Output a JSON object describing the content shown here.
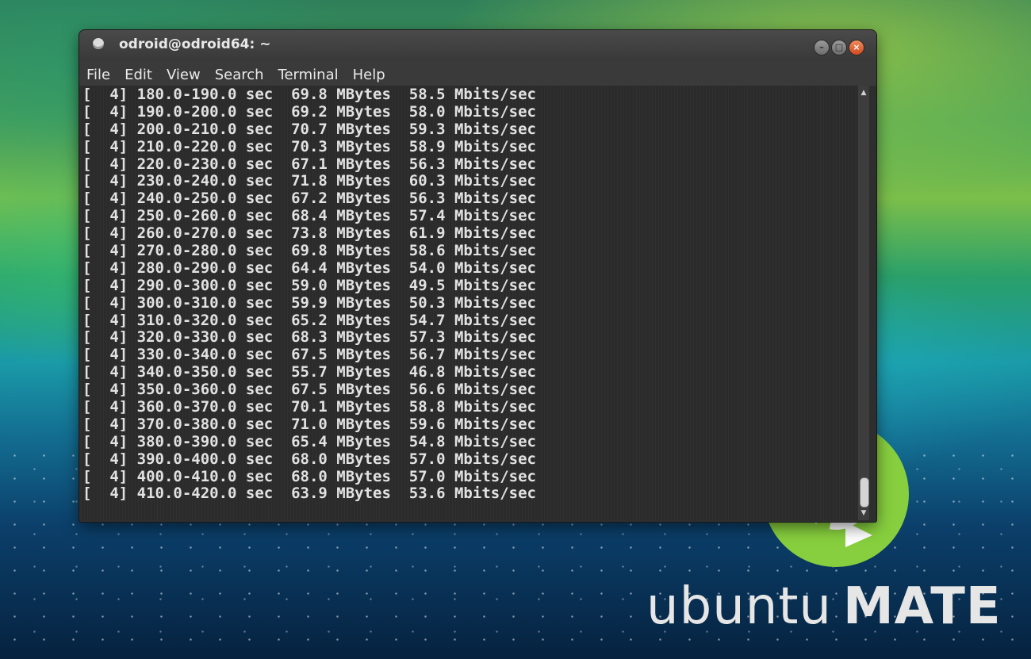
{
  "window": {
    "title": "odroid@odroid64: ~",
    "buttons": {
      "minimize_icon": "minimize-icon",
      "maximize_icon": "maximize-icon",
      "close_icon": "close-icon"
    }
  },
  "menubar": {
    "items": [
      {
        "label": "File"
      },
      {
        "label": "Edit"
      },
      {
        "label": "View"
      },
      {
        "label": "Search"
      },
      {
        "label": "Terminal"
      },
      {
        "label": "Help"
      }
    ]
  },
  "terminal": {
    "lines": [
      "[  4] 180.0-190.0 sec  69.8 MBytes  58.5 Mbits/sec",
      "[  4] 190.0-200.0 sec  69.2 MBytes  58.0 Mbits/sec",
      "[  4] 200.0-210.0 sec  70.7 MBytes  59.3 Mbits/sec",
      "[  4] 210.0-220.0 sec  70.3 MBytes  58.9 Mbits/sec",
      "[  4] 220.0-230.0 sec  67.1 MBytes  56.3 Mbits/sec",
      "[  4] 230.0-240.0 sec  71.8 MBytes  60.3 Mbits/sec",
      "[  4] 240.0-250.0 sec  67.2 MBytes  56.3 Mbits/sec",
      "[  4] 250.0-260.0 sec  68.4 MBytes  57.4 Mbits/sec",
      "[  4] 260.0-270.0 sec  73.8 MBytes  61.9 Mbits/sec",
      "[  4] 270.0-280.0 sec  69.8 MBytes  58.6 Mbits/sec",
      "[  4] 280.0-290.0 sec  64.4 MBytes  54.0 Mbits/sec",
      "[  4] 290.0-300.0 sec  59.0 MBytes  49.5 Mbits/sec",
      "[  4] 300.0-310.0 sec  59.9 MBytes  50.3 Mbits/sec",
      "[  4] 310.0-320.0 sec  65.2 MBytes  54.7 Mbits/sec",
      "[  4] 320.0-330.0 sec  68.3 MBytes  57.3 Mbits/sec",
      "[  4] 330.0-340.0 sec  67.5 MBytes  56.7 Mbits/sec",
      "[  4] 340.0-350.0 sec  55.7 MBytes  46.8 Mbits/sec",
      "[  4] 350.0-360.0 sec  67.5 MBytes  56.6 Mbits/sec",
      "[  4] 360.0-370.0 sec  70.1 MBytes  58.8 Mbits/sec",
      "[  4] 370.0-380.0 sec  71.0 MBytes  59.6 Mbits/sec",
      "[  4] 380.0-390.0 sec  65.4 MBytes  54.8 Mbits/sec",
      "[  4] 390.0-400.0 sec  68.0 MBytes  57.0 Mbits/sec",
      "[  4] 400.0-410.0 sec  68.0 MBytes  57.0 Mbits/sec",
      "[  4] 410.0-420.0 sec  63.9 MBytes  53.6 Mbits/sec"
    ]
  },
  "desktop": {
    "brand_light": "ubuntu",
    "brand_bold": "MATE",
    "logo_icon": "ubuntu-mate-logo-icon"
  },
  "colors": {
    "terminal_bg": "#2b2b2b",
    "terminal_fg": "#e2e2e2",
    "titlebar": "#3f3f3f",
    "close_button": "#e0622f",
    "mate_green": "#87cf3e"
  }
}
